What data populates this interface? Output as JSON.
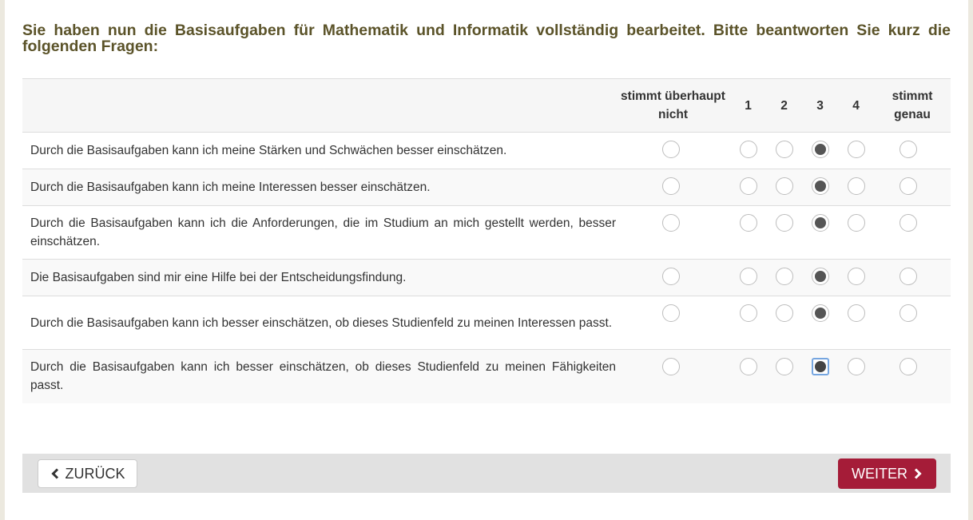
{
  "heading": "Sie haben nun die Basisaufgaben für Mathematik und Informatik vollständig bearbeitet. Bitte beantworten Sie kurz die folgenden Fragen:",
  "scale": {
    "labels": [
      "stimmt überhaupt nicht",
      "1",
      "2",
      "3",
      "4",
      "stimmt genau"
    ]
  },
  "questions": [
    {
      "text": "Durch die Basisaufgaben kann ich meine Stärken und Schwächen besser einschätzen.",
      "selected": "3"
    },
    {
      "text": "Durch die Basisaufgaben kann ich meine Interessen besser einschätzen.",
      "selected": "3"
    },
    {
      "text": "Durch die Basisaufgaben kann ich die Anforderungen, die im Studium an mich gestellt werden, besser einschätzen.",
      "selected": "3"
    },
    {
      "text": "Die Basisaufgaben sind mir eine Hilfe bei der Entscheidungsfindung.",
      "selected": "3"
    },
    {
      "text": "Durch die Basisaufgaben kann ich besser einschätzen, ob dieses Studienfeld zu meinen Interessen passt.",
      "selected": "3"
    },
    {
      "text": "Durch die Basisaufgaben kann ich besser einschätzen, ob dieses Studienfeld zu meinen Fähigkeiten passt.",
      "selected": "3",
      "focused": true
    }
  ],
  "nav": {
    "back_label": "ZURÜCK",
    "next_label": "WEITER",
    "back_icon": "chevron-left-icon",
    "next_icon": "chevron-right-icon"
  },
  "colors": {
    "heading": "#5b5329",
    "next_button": "#a51c38",
    "nav_bar": "#e1e1e1",
    "radio_fill": "#555555",
    "focus_ring": "#76a6e0"
  }
}
